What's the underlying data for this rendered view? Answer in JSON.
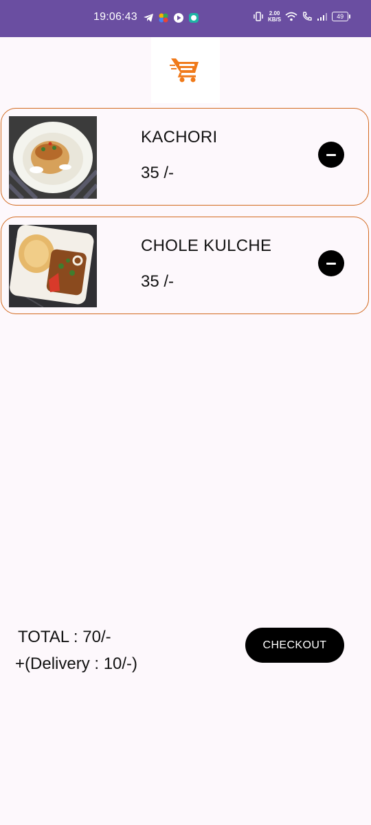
{
  "status_bar": {
    "time": "19:06:43",
    "net_speed_value": "2.00",
    "net_speed_unit": "KB/S",
    "battery": "49"
  },
  "app": {
    "logo_icon": "shopping-cart-logo-icon",
    "accent_color": "#d2691e",
    "logo_color": "#f07a1a"
  },
  "cart": {
    "items": [
      {
        "name": "KACHORI",
        "price": "35 /-",
        "image": "kachori-photo",
        "remove_icon": "minus-circle-icon"
      },
      {
        "name": "CHOLE KULCHE",
        "price": "35 /-",
        "image": "chole-kulche-photo",
        "remove_icon": "minus-circle-icon"
      }
    ]
  },
  "summary": {
    "total": "TOTAL : 70/-",
    "delivery": "+(Delivery : 10/-)",
    "checkout_label": "CHECKOUT"
  }
}
